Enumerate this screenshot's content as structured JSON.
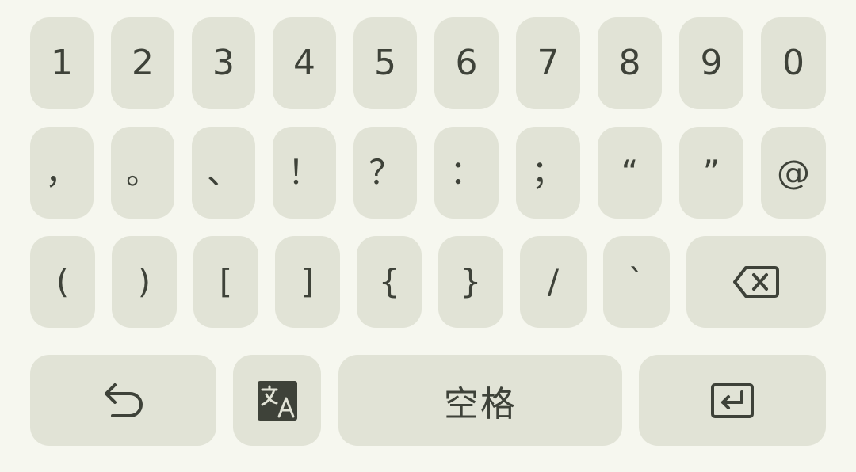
{
  "keyboard": {
    "row1": [
      "1",
      "2",
      "3",
      "4",
      "5",
      "6",
      "7",
      "8",
      "9",
      "0"
    ],
    "row2": [
      "，",
      "。",
      "、",
      "！",
      "？",
      "：",
      "；",
      "“",
      "”",
      "@"
    ],
    "row3": [
      "(",
      ")",
      "[",
      "]",
      "{",
      "}",
      "/",
      "`"
    ],
    "bottom": {
      "space_label": "空格"
    },
    "icons": {
      "backspace": "backspace-icon",
      "undo": "undo-icon",
      "translate": "translate-icon",
      "enter": "enter-icon"
    },
    "colors": {
      "background": "#f6f7ef",
      "key": "#e1e3d6",
      "text": "#3e4239"
    }
  }
}
